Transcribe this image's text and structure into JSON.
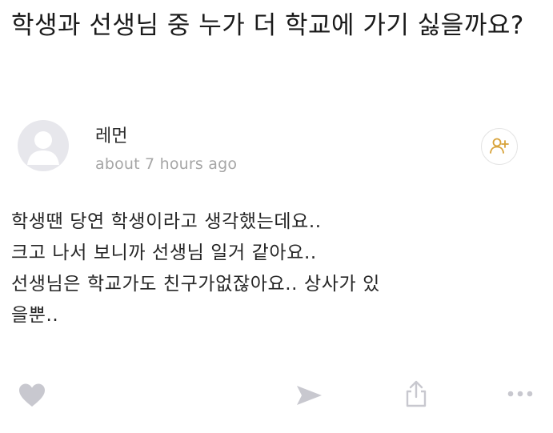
{
  "question": {
    "title": "학생과 선생님 중 누가 더 학교에 가기 싫을까요?"
  },
  "answer": {
    "author": {
      "name": "레먼",
      "timestamp": "about 7 hours ago"
    },
    "lines": [
      "학생땐 당연 학생이라고 생각했는데요..",
      "크고 나서 보니까 선생님 일거 같아요..",
      "선생님은 학교가도 친구가없잖아요.. 상사가 있",
      "을뿐.."
    ]
  },
  "icons": {
    "avatar": "default-avatar-icon",
    "follow": "add-user-icon",
    "like": "heart-icon",
    "send": "send-icon",
    "upload": "share-upload-icon",
    "more": "more-horizontal-icon"
  },
  "colors": {
    "text": "#1a1a1a",
    "muted": "#a6a6a6",
    "icon": "#c8c8cf",
    "follow_accent": "#d8a33a"
  }
}
